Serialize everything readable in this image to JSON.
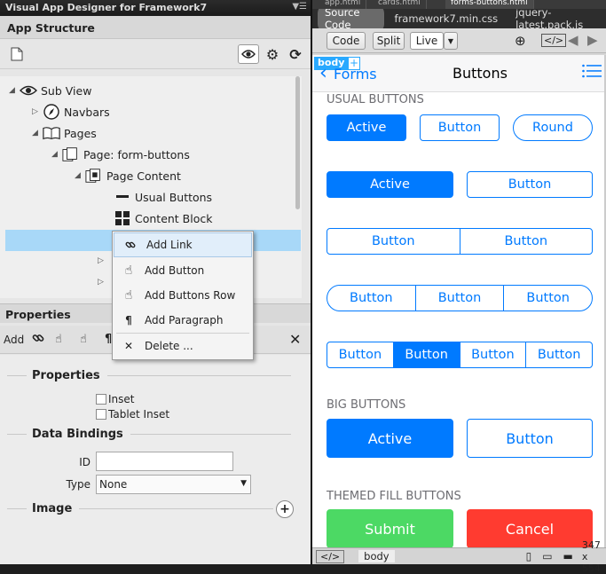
{
  "left": {
    "title": "Visual App Designer for Framework7",
    "app_structure": "App Structure",
    "tree": [
      {
        "label": "Sub View",
        "icon": "eye-icon"
      },
      {
        "label": "Navbars",
        "icon": "compass-icon"
      },
      {
        "label": "Pages",
        "icon": "book-icon"
      },
      {
        "label": "Page: form-buttons",
        "icon": "page-icon"
      },
      {
        "label": "Page Content",
        "icon": "page-content-icon"
      },
      {
        "label": "Usual Buttons",
        "icon": "minus-icon"
      },
      {
        "label": "Content Block",
        "icon": "grid-icon"
      }
    ],
    "context_menu": [
      {
        "label": "Add Link",
        "icon": "link-icon"
      },
      {
        "label": "Add Button",
        "icon": "hand-pointer-icon"
      },
      {
        "label": "Add Buttons Row",
        "icon": "hand-pointer-icon"
      },
      {
        "label": "Add Paragraph",
        "icon": "pilcrow-icon"
      },
      {
        "label": "Delete ...",
        "icon": "close-icon"
      }
    ],
    "properties_title": "Properties",
    "props_add": "Add",
    "group_properties": "Properties",
    "chk_inset": "Inset",
    "chk_tablet_inset": "Tablet Inset",
    "group_bindings": "Data Bindings",
    "id_label": "ID",
    "type_label": "Type",
    "type_value": "None",
    "group_image": "Image"
  },
  "right": {
    "tabs": [
      "app.html",
      "cards.html",
      "forms-buttons.html"
    ],
    "files": [
      "Source Code",
      "framework7.min.css",
      "jquery-latest.pack.js"
    ],
    "view_buttons": [
      "Code",
      "Split",
      "Live"
    ],
    "body_tag": "body",
    "plus": "+",
    "nav_back": "Forms",
    "nav_title": "Buttons",
    "sec_usual": "USUAL BUTTONS",
    "sec_big": "BIG BUTTONS",
    "sec_themed": "THEMED FILL BUTTONS",
    "btn_active": "Active",
    "btn_button": "Button",
    "btn_round": "Round",
    "btn_submit": "Submit",
    "btn_cancel": "Cancel",
    "status_tag": "body",
    "status_code": "</>",
    "status_size": "347 x 554"
  },
  "colors": {
    "accent": "#007aff",
    "green": "#4cd964",
    "red": "#ff3b30",
    "selection": "#a8d8f8"
  }
}
